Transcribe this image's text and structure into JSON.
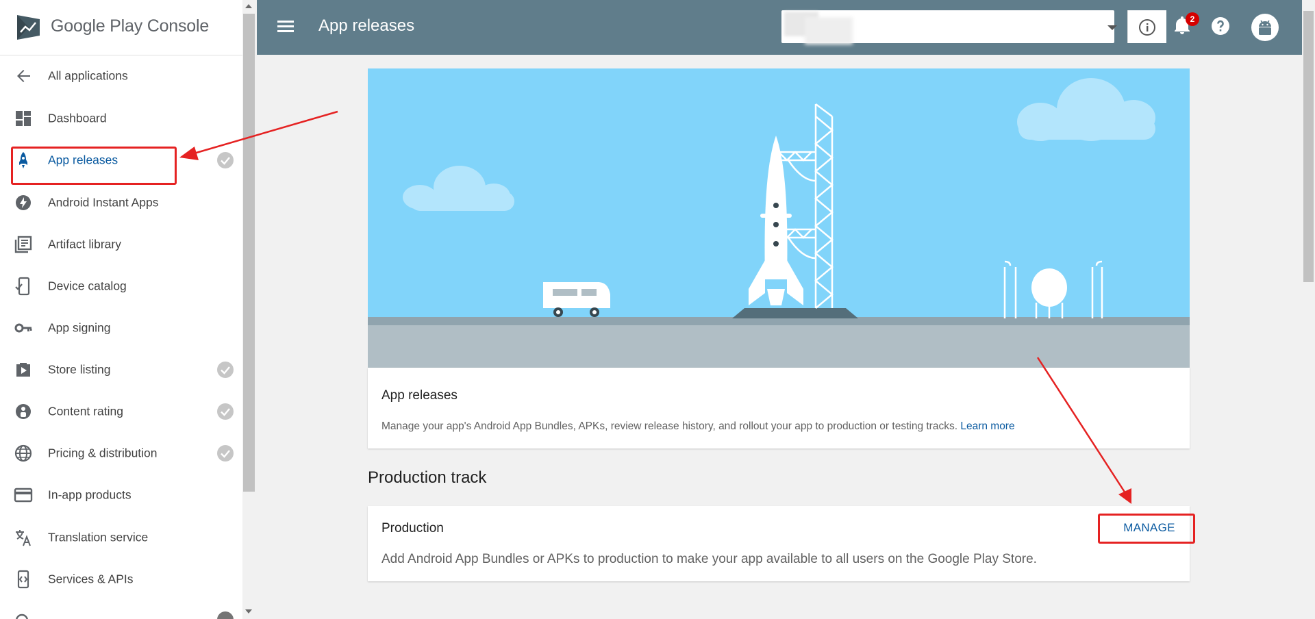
{
  "colors": {
    "header_bg": "#607d8b",
    "accent_blue": "#0a5aa0",
    "annotation_red": "#e52222",
    "sky": "#81d4fa",
    "ground": "#b0bec5",
    "badge_red": "#d50000"
  },
  "sidebar": {
    "logo": {
      "text": "Google Play Console",
      "icon": "play-console-logo-icon"
    },
    "items": [
      {
        "label": "All applications",
        "icon": "arrow-back-icon",
        "checked": false
      },
      {
        "label": "Dashboard",
        "icon": "dashboard-icon",
        "checked": false
      },
      {
        "label": "App releases",
        "icon": "rocket-icon",
        "checked": true,
        "active": true
      },
      {
        "label": "Android Instant Apps",
        "icon": "lightning-icon",
        "checked": false
      },
      {
        "label": "Artifact library",
        "icon": "library-icon",
        "checked": false
      },
      {
        "label": "Device catalog",
        "icon": "device-icon",
        "checked": false
      },
      {
        "label": "App signing",
        "icon": "key-icon",
        "checked": false
      },
      {
        "label": "Store listing",
        "icon": "store-icon",
        "checked": true
      },
      {
        "label": "Content rating",
        "icon": "rating-icon",
        "checked": true
      },
      {
        "label": "Pricing & distribution",
        "icon": "globe-icon",
        "checked": true
      },
      {
        "label": "In-app products",
        "icon": "credit-card-icon",
        "checked": false
      },
      {
        "label": "Translation service",
        "icon": "translate-icon",
        "checked": false
      },
      {
        "label": "Services & APIs",
        "icon": "code-icon",
        "checked": false
      }
    ]
  },
  "header": {
    "title": "App releases",
    "notification_count": "2",
    "icons": [
      "menu-icon",
      "info-icon",
      "notifications-icon",
      "help-icon",
      "android-avatar-icon"
    ]
  },
  "main": {
    "info_card": {
      "title": "App releases",
      "description": "Manage your app's Android App Bundles, APKs, review release history, and rollout your app to production or testing tracks.",
      "link": "Learn more"
    },
    "section_title": "Production track",
    "production_card": {
      "title": "Production",
      "description": "Add Android App Bundles or APKs to production to make your app available to all users on the Google Play Store.",
      "action": "MANAGE"
    }
  }
}
